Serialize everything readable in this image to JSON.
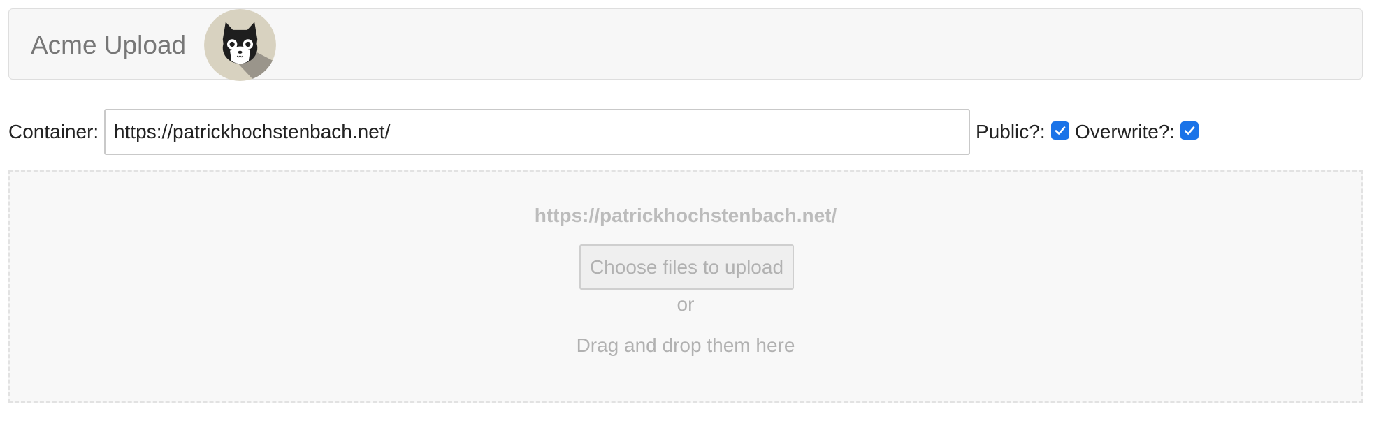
{
  "header": {
    "brand": "Acme Upload",
    "logo_icon": "cat-avatar-icon"
  },
  "form": {
    "container_label": "Container:",
    "container_value": "https://patrickhochstenbach.net/",
    "public_label": "Public?:",
    "public_checked": true,
    "overwrite_label": "Overwrite?:",
    "overwrite_checked": true,
    "accent_color": "#1a73e8"
  },
  "dropzone": {
    "target": "https://patrickhochstenbach.net/",
    "button_label": "Choose files to upload",
    "or_text": "or",
    "drag_text": "Drag and drop them here"
  }
}
